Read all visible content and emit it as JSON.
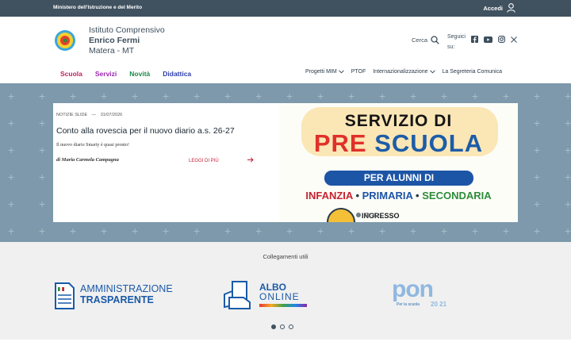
{
  "topbar": {
    "ministry": "Ministero dell'Istruzione e del Merito",
    "login": "Accedi"
  },
  "header": {
    "line1": "Istituto Comprensivo",
    "line2": "Enrico Fermi",
    "line3": "Matera - MT",
    "search": "Cerca",
    "social_label": "Seguici su:",
    "social_icons": [
      "facebook-icon",
      "youtube-icon",
      "instagram-icon",
      "x-icon"
    ]
  },
  "nav": {
    "main": [
      {
        "label": "Scuola",
        "color": "#c21d5e"
      },
      {
        "label": "Servizi",
        "color": "#9b27af"
      },
      {
        "label": "Novità",
        "color": "#1a8a4a"
      },
      {
        "label": "Didattica",
        "color": "#2d3ea8"
      }
    ],
    "right": [
      {
        "label": "Progetti MIM",
        "dropdown": true
      },
      {
        "label": "PTOF",
        "dropdown": false
      },
      {
        "label": "Internazionalizzazione",
        "dropdown": true
      },
      {
        "label": "La Segreteria Comunica",
        "dropdown": false
      }
    ]
  },
  "slide": {
    "category": "NOTIZIE SLIDE",
    "date": "31/07/2026",
    "title": "Conto alla rovescia per il nuovo diario a.s. 26-27",
    "description": "Il nuovo diario Smarty è quasi pronto!",
    "author": "di Maria Carmela Campagna",
    "read_more": "LEGGI DI PIÙ",
    "poster": {
      "line1": "SERVIZIO DI",
      "line2a": "PRE",
      "line2b": "SCUOLA",
      "band": "PER ALUNNI DI",
      "level1": "INFANZIA",
      "level2": "PRIMARIA",
      "level3": "SECONDARIA",
      "sep": "•",
      "ingresso": "INGRESSO"
    },
    "dots_count": 3,
    "active_dot": 0
  },
  "links": {
    "title": "Collegamenti utili",
    "amm_line1": "AMMINISTRAZIONE",
    "amm_line2": "TRASPARENTE",
    "albo_line1": "ALBO",
    "albo_line2": "ONLINE",
    "pon_word": "pon",
    "pon_sub": "Per la scuola",
    "pon_year": "20 21",
    "dots_count": 3,
    "active_dot": 0
  }
}
